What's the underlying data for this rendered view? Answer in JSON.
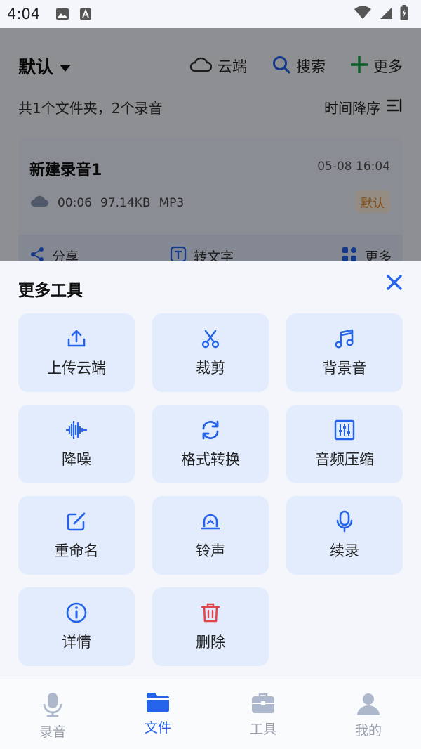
{
  "status_bar": {
    "time": "4:04"
  },
  "header": {
    "title": "默认",
    "actions": [
      {
        "label": "云端",
        "icon": "cloud-icon"
      },
      {
        "label": "搜索",
        "icon": "search-icon"
      },
      {
        "label": "更多",
        "icon": "plus-icon"
      }
    ]
  },
  "summary": {
    "text": "共1个文件夹，2个录音",
    "sort_label": "时间降序"
  },
  "recording_card": {
    "name": "新建录音1",
    "date": "05-08 16:04",
    "duration": "00:06",
    "size": "97.14KB",
    "format": "MP3",
    "badge": "默认",
    "actions": [
      {
        "label": "分享",
        "icon": "share-icon"
      },
      {
        "label": "转文字",
        "icon": "text-icon"
      },
      {
        "label": "更多",
        "icon": "grid-icon"
      }
    ]
  },
  "sheet": {
    "title": "更多工具",
    "tools": [
      {
        "label": "上传云端",
        "icon": "upload-icon"
      },
      {
        "label": "裁剪",
        "icon": "scissors-icon"
      },
      {
        "label": "背景音",
        "icon": "music-icon"
      },
      {
        "label": "降噪",
        "icon": "waveform-icon"
      },
      {
        "label": "格式转换",
        "icon": "convert-icon"
      },
      {
        "label": "音频压缩",
        "icon": "equalizer-icon"
      },
      {
        "label": "重命名",
        "icon": "edit-icon"
      },
      {
        "label": "铃声",
        "icon": "bell-icon"
      },
      {
        "label": "续录",
        "icon": "microphone-icon"
      },
      {
        "label": "详情",
        "icon": "info-icon"
      },
      {
        "label": "删除",
        "icon": "trash-icon"
      }
    ]
  },
  "tabbar": {
    "active": "文件",
    "tabs": [
      {
        "label": "录音",
        "icon": "microphone-icon"
      },
      {
        "label": "文件",
        "icon": "folder-icon"
      },
      {
        "label": "工具",
        "icon": "toolbox-icon"
      },
      {
        "label": "我的",
        "icon": "user-icon"
      }
    ]
  },
  "colors": {
    "accent": "#2563eb",
    "danger": "#e4474b",
    "tile": "#e2ecfc",
    "badge_text": "#e58a2b"
  }
}
